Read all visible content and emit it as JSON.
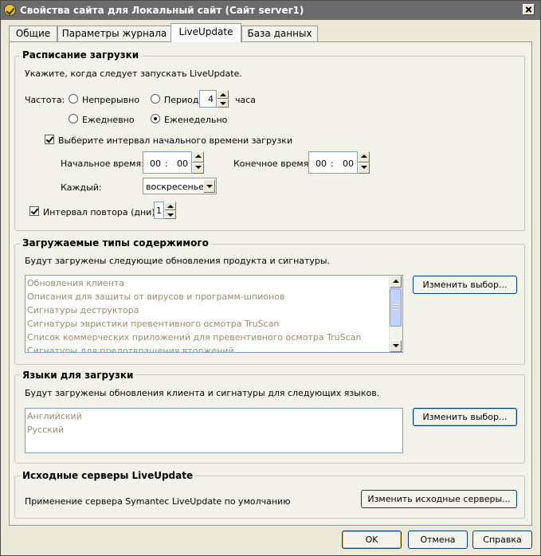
{
  "window": {
    "title": "Свойства сайта для Локальный сайт (Сайт server1)"
  },
  "tabs": [
    {
      "label": "Общие"
    },
    {
      "label": "Параметры журнала"
    },
    {
      "label": "LiveUpdate"
    },
    {
      "label": "База данных"
    }
  ],
  "schedule": {
    "title": "Расписание загрузки",
    "hint": "Укажите, когда следует запускать LiveUpdate.",
    "frequency_label": "Частота:",
    "opt_continuous": "Непрерывно",
    "opt_period": "Период",
    "period_value": "4",
    "period_unit": "часа",
    "opt_daily": "Ежедневно",
    "opt_weekly": "Еженедельно",
    "selected": "weekly",
    "interval_check_label": "Выберите интервал начального времени загрузки",
    "interval_checked": true,
    "start_label": "Начальное время:",
    "start_hour": "00",
    "start_min": "00",
    "end_label": "Конечное время:",
    "end_hour": "00",
    "end_min": "00",
    "time_sep": ":",
    "every_label": "Каждый:",
    "every_value": "воскресенье",
    "repeat_label": "Интервал повтора (дни):",
    "repeat_checked": true,
    "repeat_value": "1"
  },
  "content": {
    "title": "Загружаемые типы содержимого",
    "hint": "Будут загружены следующие обновления продукта и сигнатуры.",
    "items": [
      "Обновления клиента",
      "Описания для защиты от вирусов и программ-шпионов",
      "Сигнатуры деструктора",
      "Сигнатуры эвристики превентивного осмотра TruScan",
      "Список коммерческих приложений для превентивного осмотра TruScan",
      "Сигнатуры для предотвращения вторжений"
    ],
    "change_button": "Изменить выбор..."
  },
  "languages": {
    "title": "Языки для загрузки",
    "hint": "Будут загружены обновления клиента и сигнатуры для следующих языков.",
    "items": [
      "Английский",
      "Русский"
    ],
    "change_button": "Изменить выбор..."
  },
  "servers": {
    "title": "Исходные серверы LiveUpdate",
    "hint": "Применение сервера Symantec LiveUpdate по умолчанию",
    "change_button": "Изменить исходные серверы..."
  },
  "footer": {
    "ok": "OK",
    "cancel": "Отмена",
    "help": "Справка"
  }
}
